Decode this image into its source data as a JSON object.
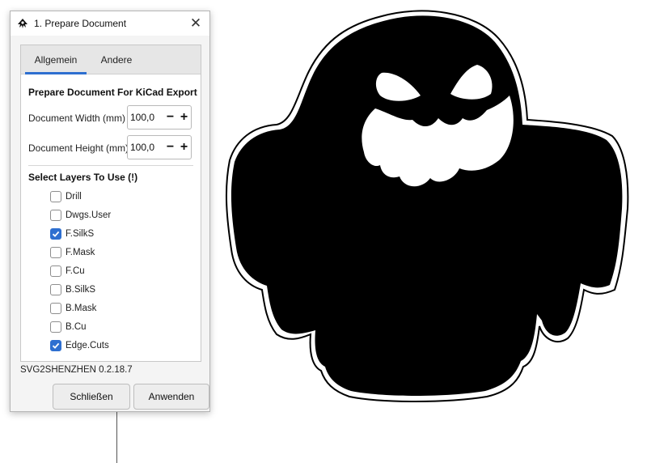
{
  "dialog": {
    "title": "1. Prepare Document",
    "tabs": [
      {
        "label": "Allgemein",
        "active": true
      },
      {
        "label": "Andere",
        "active": false
      }
    ],
    "section_export": "Prepare Document For KiCad Export",
    "fields": [
      {
        "label": "Document Width (mm)",
        "value": "100,0"
      },
      {
        "label": "Document Height (mm)",
        "value": "100,0"
      }
    ],
    "section_layers": "Select Layers To Use (!)",
    "layers": [
      {
        "label": "Drill",
        "checked": false
      },
      {
        "label": "Dwgs.User",
        "checked": false
      },
      {
        "label": "F.SilkS",
        "checked": true
      },
      {
        "label": "F.Mask",
        "checked": false
      },
      {
        "label": "F.Cu",
        "checked": false
      },
      {
        "label": "B.SilkS",
        "checked": false
      },
      {
        "label": "B.Mask",
        "checked": false
      },
      {
        "label": "B.Cu",
        "checked": false
      },
      {
        "label": "Edge.Cuts",
        "checked": true
      }
    ],
    "version": "SVG2SHENZHEN 0.2.18.7",
    "buttons": {
      "close": "Schließen",
      "apply": "Anwenden"
    },
    "icons": {
      "app": "inkscape-icon",
      "close": "close-icon"
    },
    "accent_color": "#2e6fd0"
  },
  "canvas": {
    "drawing": "ghost-silhouette"
  }
}
